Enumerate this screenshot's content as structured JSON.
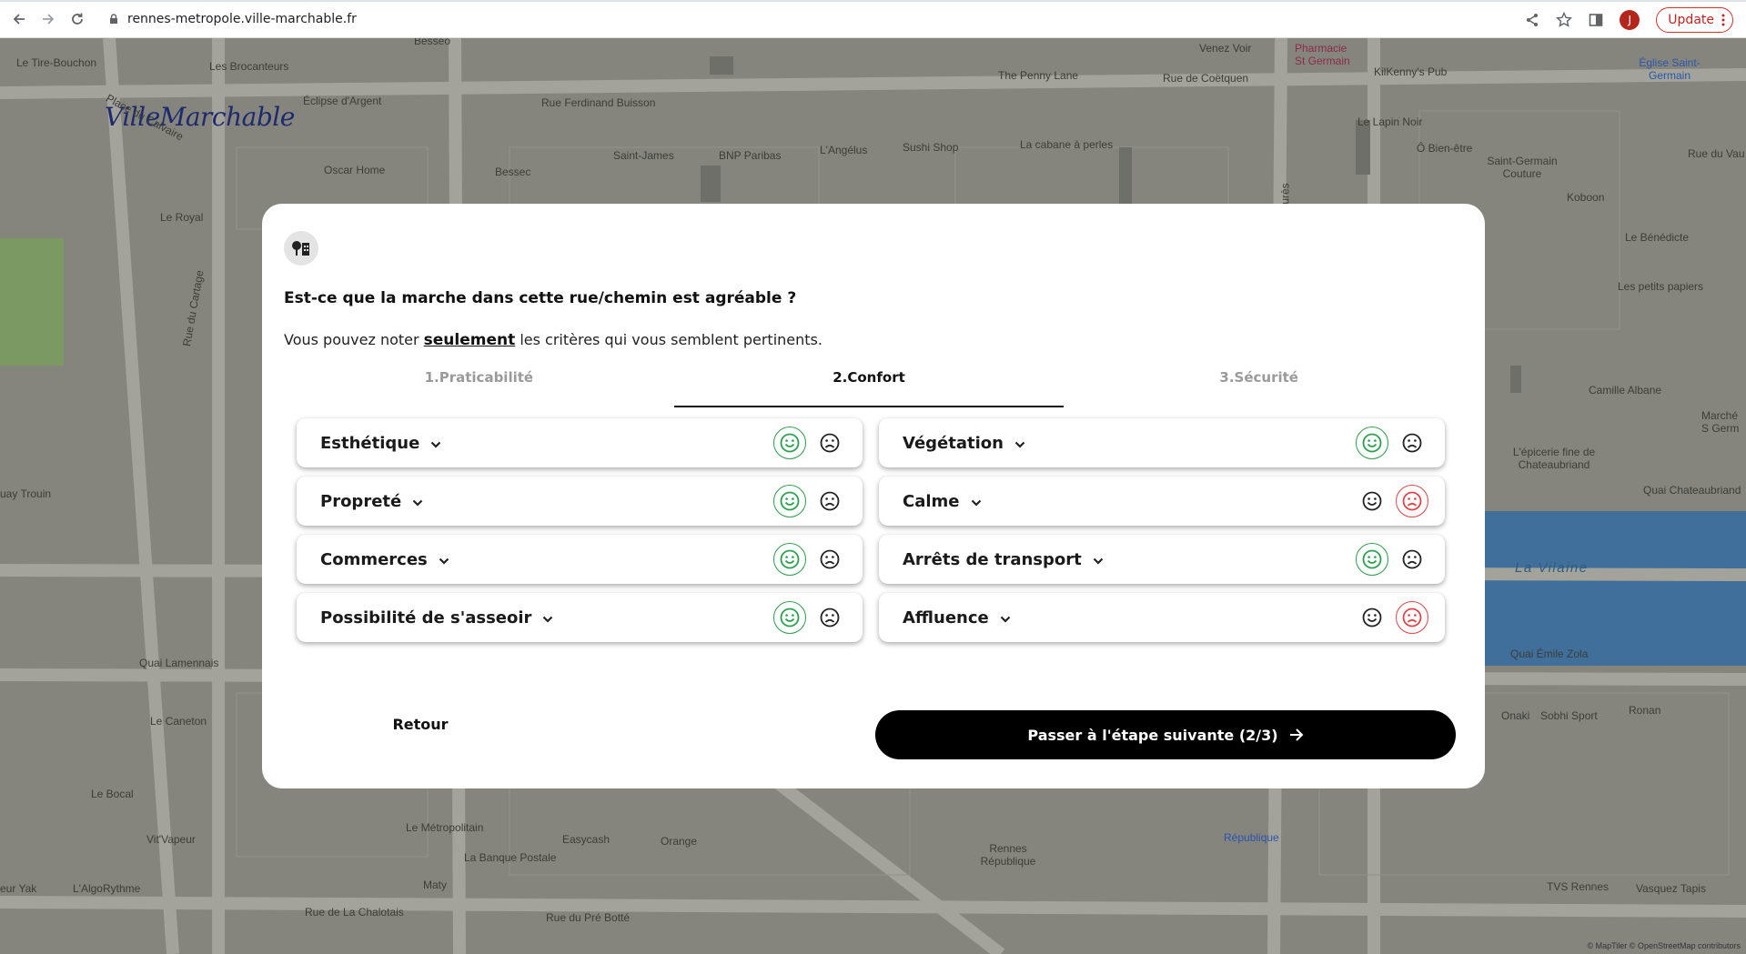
{
  "browser": {
    "url": "rennes-metropole.ville-marchable.fr",
    "profile_initial": "J",
    "update_label": "Update",
    "icons": [
      "back-icon",
      "forward-icon",
      "reload-icon",
      "lock-icon",
      "share-icon",
      "star-icon",
      "sidepanel-icon",
      "kebab-icon"
    ]
  },
  "map": {
    "logo": "VilleMarchable",
    "attribution": "© MapTiler © OpenStreetMap contributors",
    "labels": [
      {
        "text": "Le Tire-Bouchon",
        "tone": "dark"
      },
      {
        "text": "Les Brocanteurs",
        "tone": "dark"
      },
      {
        "text": "Besseo",
        "tone": "dark"
      },
      {
        "text": "Venez Voir",
        "tone": "dark"
      },
      {
        "text": "Pharmacie St Germain",
        "tone": "pink"
      },
      {
        "text": "Église Saint-Germain",
        "tone": "blue"
      },
      {
        "text": "The Penny Lane",
        "tone": "dark"
      },
      {
        "text": "Rue de Coëtquen",
        "tone": "dark"
      },
      {
        "text": "KilKenny's Pub",
        "tone": "dark"
      },
      {
        "text": "Éclipse d'Argent",
        "tone": "dark"
      },
      {
        "text": "Rue Ferdinand Buisson",
        "tone": "dark"
      },
      {
        "text": "Place du Calvaire",
        "tone": "dark"
      },
      {
        "text": "Le Lapin Noir",
        "tone": "dark"
      },
      {
        "text": "Saint-James",
        "tone": "dark"
      },
      {
        "text": "BNP Paribas",
        "tone": "dark"
      },
      {
        "text": "L'Angélus",
        "tone": "dark"
      },
      {
        "text": "Sushi Shop",
        "tone": "dark"
      },
      {
        "text": "La cabane à perles",
        "tone": "dark"
      },
      {
        "text": "Ô Bien-être",
        "tone": "dark"
      },
      {
        "text": "Rue du Vau",
        "tone": "dark"
      },
      {
        "text": "Oscar Home",
        "tone": "dark"
      },
      {
        "text": "Bessec",
        "tone": "dark"
      },
      {
        "text": "Saint-Germain Couture",
        "tone": "dark"
      },
      {
        "text": "Koboon",
        "tone": "dark"
      },
      {
        "text": "Le Royal",
        "tone": "dark"
      },
      {
        "text": "Le Bénédicte",
        "tone": "dark"
      },
      {
        "text": "Les petits papiers",
        "tone": "dark"
      },
      {
        "text": "Camille Albane",
        "tone": "dark"
      },
      {
        "text": "Marché S Germ",
        "tone": "dark"
      },
      {
        "text": "L'épicerie fine de Chateaubriand",
        "tone": "dark"
      },
      {
        "text": "Quai Chateaubriand",
        "tone": "dark"
      },
      {
        "text": "uay Trouin",
        "tone": "dark"
      },
      {
        "text": "La Vilaine",
        "tone": "water"
      },
      {
        "text": "Quai Émile Zola",
        "tone": "dark"
      },
      {
        "text": "Quai Lamennais",
        "tone": "dark"
      },
      {
        "text": "Onaki",
        "tone": "dark"
      },
      {
        "text": "Sobhi Sport",
        "tone": "dark"
      },
      {
        "text": "Ronan",
        "tone": "dark"
      },
      {
        "text": "Le Caneton",
        "tone": "dark"
      },
      {
        "text": "Le Bocal",
        "tone": "dark"
      },
      {
        "text": "Vit'Vapeur",
        "tone": "dark"
      },
      {
        "text": "Le Métropolitain",
        "tone": "dark"
      },
      {
        "text": "Easycash",
        "tone": "dark"
      },
      {
        "text": "Orange",
        "tone": "dark"
      },
      {
        "text": "La Banque Postale",
        "tone": "dark"
      },
      {
        "text": "Rennes République",
        "tone": "dark"
      },
      {
        "text": "République",
        "tone": "blue"
      },
      {
        "text": "TVS Rennes",
        "tone": "dark"
      },
      {
        "text": "Vasquez Tapis",
        "tone": "dark"
      },
      {
        "text": "eur Yak",
        "tone": "dark"
      },
      {
        "text": "L'AlgoRythme",
        "tone": "dark"
      },
      {
        "text": "Maty",
        "tone": "dark"
      },
      {
        "text": "Rue de La Chalotais",
        "tone": "dark"
      },
      {
        "text": "Rue du Pré Botté",
        "tone": "dark"
      },
      {
        "text": "Rue du Cartage",
        "tone": "dark"
      },
      {
        "text": "Jean Jaurès",
        "tone": "dark"
      }
    ]
  },
  "modal": {
    "question": "Est-ce que la marche dans cette rue/chemin est agréable ?",
    "subtitle_before": "Vous pouvez noter ",
    "subtitle_strong": "seulement",
    "subtitle_after": " les critères qui vous semblent pertinents.",
    "tabs": [
      {
        "label": "1.Praticabilité",
        "active": false
      },
      {
        "label": "2.Confort",
        "active": true
      },
      {
        "label": "3.Sécurité",
        "active": false
      }
    ],
    "criteria": [
      {
        "label": "Esthétique",
        "selected": "good"
      },
      {
        "label": "Végétation",
        "selected": "good"
      },
      {
        "label": "Propreté",
        "selected": "good"
      },
      {
        "label": "Calme",
        "selected": "bad"
      },
      {
        "label": "Commerces",
        "selected": "good"
      },
      {
        "label": "Arrêts de transport",
        "selected": "good"
      },
      {
        "label": "Possibilité de s'asseoir",
        "selected": "good"
      },
      {
        "label": "Affluence",
        "selected": "bad"
      }
    ],
    "back_label": "Retour",
    "next_label": "Passer à l'étape suivante (2/3)"
  },
  "colors": {
    "good": "#2aa04a",
    "bad": "#e04444",
    "primary": "#000000",
    "map_base": "#86867f",
    "water": "#3f6f9a"
  }
}
